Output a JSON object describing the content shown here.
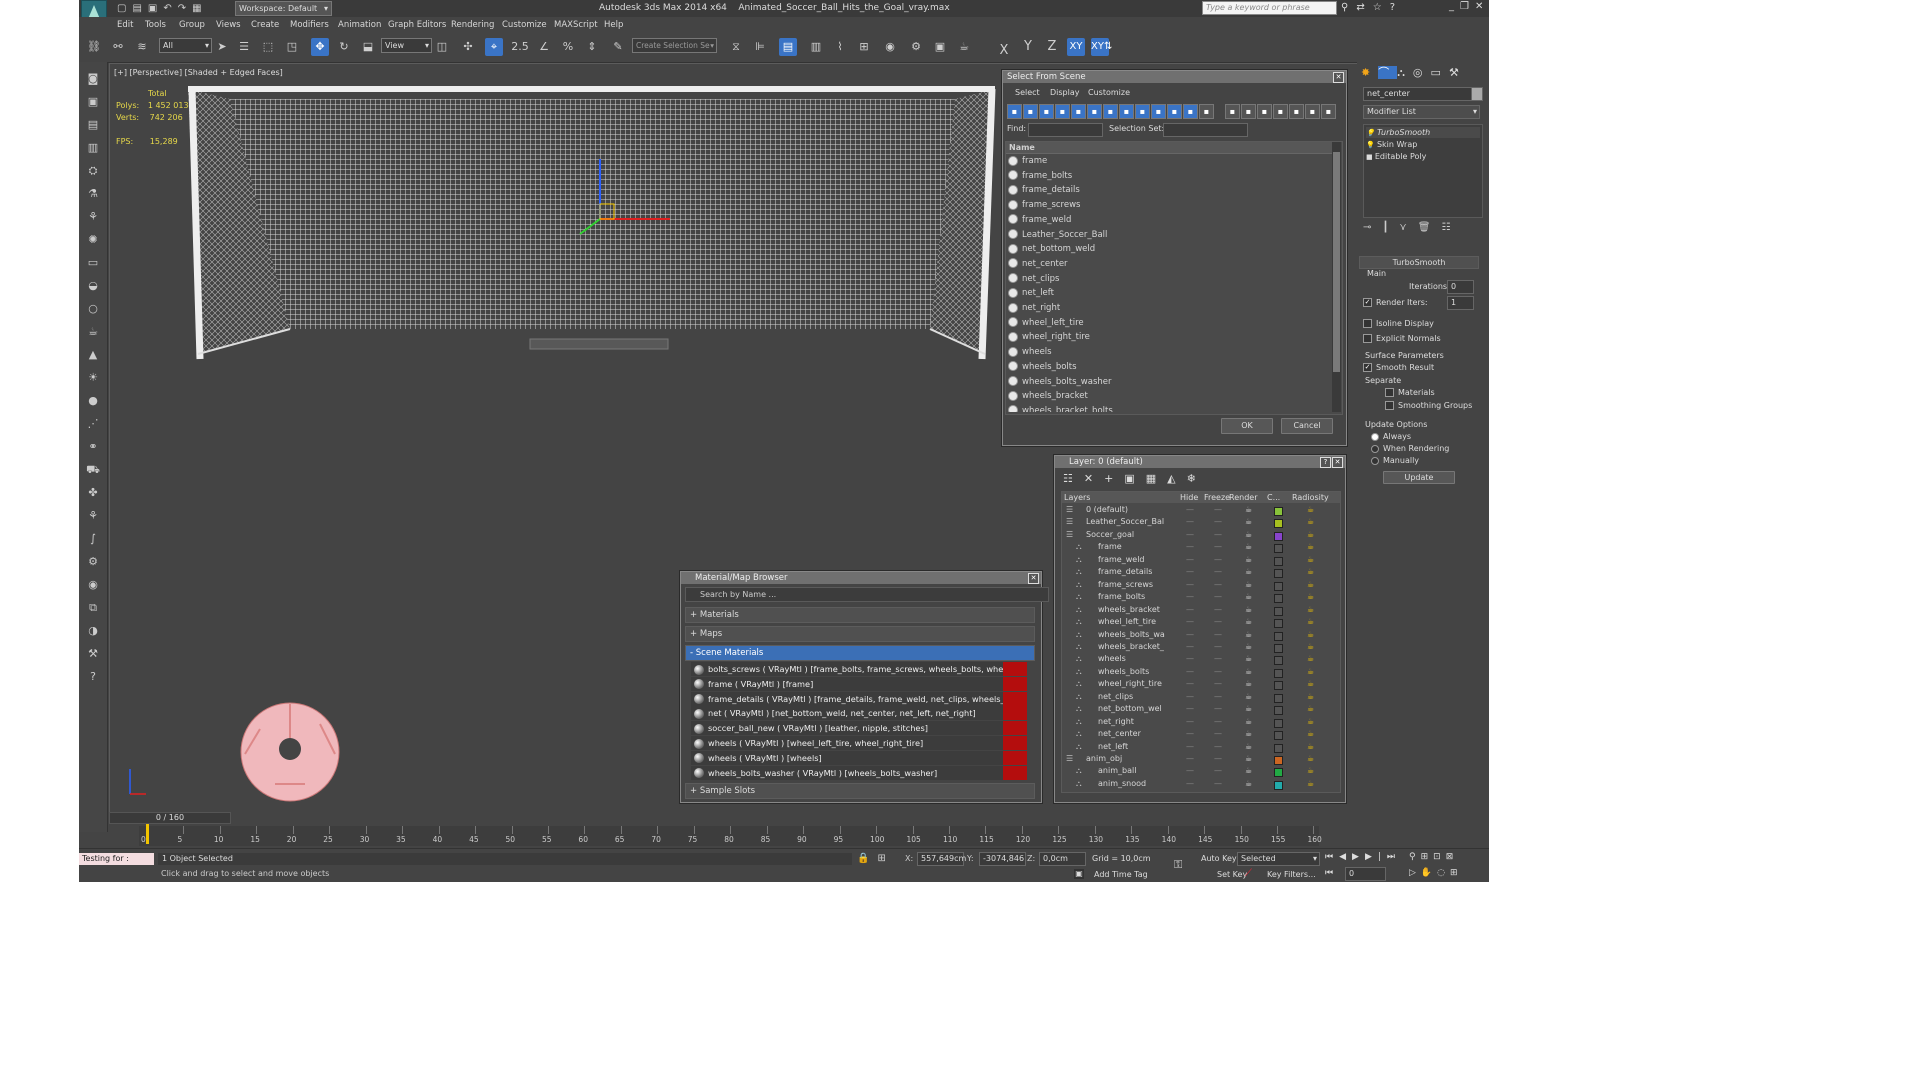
{
  "title": {
    "workspace": "Workspace: Default",
    "app": "Autodesk 3ds Max  2014 x64",
    "file": "Animated_Soccer_Ball_Hits_the_Goal_vray.max",
    "search_placeholder": "Type a keyword or phrase"
  },
  "menu": [
    "Edit",
    "Tools",
    "Group",
    "Views",
    "Create",
    "Modifiers",
    "Animation",
    "Graph Editors",
    "Rendering",
    "Customize",
    "MAXScript",
    "Help"
  ],
  "toolbar": {
    "filter": "All",
    "view": "View",
    "selection_set": "Create Selection Se",
    "snap_angle": "2.5",
    "axis_labels": [
      "X",
      "Y",
      "Z",
      "XY"
    ]
  },
  "viewport": {
    "label": "[+] [Perspective] [Shaded + Edged Faces]",
    "stats": {
      "total_label": "Total",
      "polys_label": "Polys:",
      "polys": "1 452 013",
      "verts_label": "Verts:",
      "verts": "742 206",
      "fps_label": "FPS:",
      "fps": "15,289"
    }
  },
  "select_scene": {
    "title": "Select From Scene",
    "menu": [
      "Select",
      "Display",
      "Customize"
    ],
    "find_label": "Find:",
    "selset_label": "Selection Set:",
    "column": "Name",
    "items": [
      "frame",
      "frame_bolts",
      "frame_details",
      "frame_screws",
      "frame_weld",
      "Leather_Soccer_Ball",
      "net_bottom_weld",
      "net_center",
      "net_clips",
      "net_left",
      "net_right",
      "wheel_left_tire",
      "wheel_right_tire",
      "wheels",
      "wheels_bolts",
      "wheels_bolts_washer",
      "wheels_bracket",
      "wheels_bracket_bolts"
    ],
    "ok": "OK",
    "cancel": "Cancel"
  },
  "layer": {
    "title": "Layer: 0 (default)",
    "columns": [
      "Layers",
      "Hide",
      "Freeze",
      "Render",
      "C...",
      "Radiosity"
    ],
    "rows": [
      {
        "name": "0 (default)",
        "indent": 0,
        "color": "#88c23a"
      },
      {
        "name": "Leather_Soccer_Bal",
        "indent": 0,
        "color": "#a8c020"
      },
      {
        "name": "Soccer_goal",
        "indent": 0,
        "color": "#8844cc"
      },
      {
        "name": "frame",
        "indent": 1,
        "color": "#555555"
      },
      {
        "name": "frame_weld",
        "indent": 1,
        "color": "#555555"
      },
      {
        "name": "frame_details",
        "indent": 1,
        "color": "#555555"
      },
      {
        "name": "frame_screws",
        "indent": 1,
        "color": "#555555"
      },
      {
        "name": "frame_bolts",
        "indent": 1,
        "color": "#555555"
      },
      {
        "name": "wheels_bracket",
        "indent": 1,
        "color": "#555555"
      },
      {
        "name": "wheel_left_tire",
        "indent": 1,
        "color": "#555555"
      },
      {
        "name": "wheels_bolts_wa",
        "indent": 1,
        "color": "#555555"
      },
      {
        "name": "wheels_bracket_",
        "indent": 1,
        "color": "#555555"
      },
      {
        "name": "wheels",
        "indent": 1,
        "color": "#555555"
      },
      {
        "name": "wheels_bolts",
        "indent": 1,
        "color": "#555555"
      },
      {
        "name": "wheel_right_tire",
        "indent": 1,
        "color": "#555555"
      },
      {
        "name": "net_clips",
        "indent": 1,
        "color": "#555555"
      },
      {
        "name": "net_bottom_wel",
        "indent": 1,
        "color": "#555555"
      },
      {
        "name": "net_right",
        "indent": 1,
        "color": "#555555"
      },
      {
        "name": "net_center",
        "indent": 1,
        "color": "#555555"
      },
      {
        "name": "net_left",
        "indent": 1,
        "color": "#555555"
      },
      {
        "name": "anim_obj",
        "indent": 0,
        "color": "#cc6622"
      },
      {
        "name": "anim_ball",
        "indent": 1,
        "color": "#22aa44"
      },
      {
        "name": "anim_snood",
        "indent": 1,
        "color": "#22aaaa"
      }
    ]
  },
  "material_browser": {
    "title": "Material/Map Browser",
    "search_placeholder": "Search by Name ...",
    "sections": [
      "+ Materials",
      "+ Maps",
      "- Scene Materials",
      "+ Sample Slots"
    ],
    "materials": [
      "bolts_screws ( VRayMtl ) [frame_bolts, frame_screws, wheels_bolts, wheels_brac...",
      "frame ( VRayMtl ) [frame]",
      "frame_details ( VRayMtl ) [frame_details, frame_weld, net_clips, wheels_bracket]",
      "net ( VRayMtl ) [net_bottom_weld, net_center, net_left, net_right]",
      "soccer_ball_new ( VRayMtl ) [leather, nipple, stitches]",
      "wheels ( VRayMtl ) [wheel_left_tire, wheel_right_tire]",
      "wheels ( VRayMtl ) [wheels]",
      "wheels_bolts_washer ( VRayMtl ) [wheels_bolts_washer]"
    ]
  },
  "command_panel": {
    "object_name": "net_center",
    "modifier_list": "Modifier List",
    "stack": [
      "TurboSmooth",
      "Skin Wrap",
      "Editable Poly"
    ],
    "rollout": "TurboSmooth",
    "main": "Main",
    "iterations_label": "Iterations:",
    "iterations": "0",
    "render_iters_label": "Render Iters:",
    "render_iters": "1",
    "isoline": "Isoline Display",
    "explicit": "Explicit Normals",
    "surface": "Surface Parameters",
    "smooth_result": "Smooth Result",
    "separate": "Separate",
    "materials": "Materials",
    "smoothing_groups": "Smoothing Groups",
    "update_options": "Update Options",
    "always": "Always",
    "when_rendering": "When Rendering",
    "manually": "Manually",
    "update": "Update"
  },
  "timeline": {
    "frame": "0 / 160",
    "ticks": [
      "0",
      "5",
      "10",
      "15",
      "20",
      "25",
      "30",
      "35",
      "40",
      "45",
      "50",
      "55",
      "60",
      "65",
      "70",
      "75",
      "80",
      "85",
      "90",
      "95",
      "100",
      "105",
      "110",
      "115",
      "120",
      "125",
      "130",
      "135",
      "140",
      "145",
      "150",
      "155",
      "160"
    ]
  },
  "status": {
    "script": "Testing for :",
    "selected": "1 Object Selected",
    "hint": "Click and drag to select and move objects",
    "x_label": "X:",
    "x": "557,649cm",
    "y_label": "Y:",
    "y": "-3074,846",
    "z_label": "Z:",
    "z": "0,0cm",
    "grid": "Grid = 10,0cm",
    "add_time_tag": "Add Time Tag",
    "auto_key": "Auto Key",
    "set_key": "Set Key",
    "selected_dd": "Selected",
    "key_filters": "Key Filters...",
    "frame_field": "0"
  }
}
